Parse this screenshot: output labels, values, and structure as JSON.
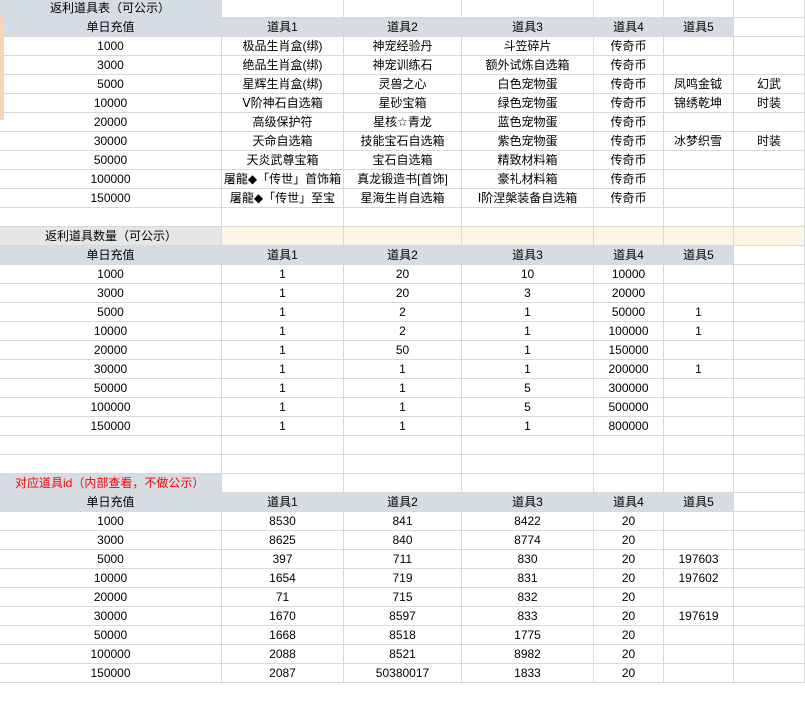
{
  "section1": {
    "title": "返利道具表（可公示）",
    "headers": [
      "单日充值",
      "道具1",
      "道具2",
      "道具3",
      "道具4",
      "道具5"
    ],
    "rows": [
      [
        "1000",
        "极品生肖盒(绑)",
        "神宠经验丹",
        "斗笠碎片",
        "传奇币",
        "",
        ""
      ],
      [
        "3000",
        "绝品生肖盒(绑)",
        "神宠训练石",
        "额外试炼自选箱",
        "传奇币",
        "",
        ""
      ],
      [
        "5000",
        "星辉生肖盒(绑)",
        "灵兽之心",
        "白色宠物蛋",
        "传奇币",
        "凤鸣金钺",
        "幻武"
      ],
      [
        "10000",
        "Ⅴ阶神石自选箱",
        "星砂宝箱",
        "绿色宠物蛋",
        "传奇币",
        "锦绣乾坤",
        "时装"
      ],
      [
        "20000",
        "高级保护符",
        "星核☆青龙",
        "蓝色宠物蛋",
        "传奇币",
        "",
        ""
      ],
      [
        "30000",
        "天命自选箱",
        "技能宝石自选箱",
        "紫色宠物蛋",
        "传奇币",
        "冰梦织雪",
        "时装"
      ],
      [
        "50000",
        "天炎武尊宝箱",
        "宝石自选箱",
        "精致材料箱",
        "传奇币",
        "",
        ""
      ],
      [
        "100000",
        "屠龍◆「传世」首饰箱",
        "真龙锻造书[首饰]",
        "豪礼材料箱",
        "传奇币",
        "",
        ""
      ],
      [
        "150000",
        "屠龍◆「传世」至宝",
        "星海生肖自选箱",
        "Ⅰ阶涅槃装备自选箱",
        "传奇币",
        "",
        ""
      ]
    ]
  },
  "section2": {
    "title": "返利道具数量（可公示）",
    "headers": [
      "单日充值",
      "道具1",
      "道具2",
      "道具3",
      "道具4",
      "道具5"
    ],
    "rows": [
      [
        "1000",
        "1",
        "20",
        "10",
        "10000",
        ""
      ],
      [
        "3000",
        "1",
        "20",
        "3",
        "20000",
        ""
      ],
      [
        "5000",
        "1",
        "2",
        "1",
        "50000",
        "1"
      ],
      [
        "10000",
        "1",
        "2",
        "1",
        "100000",
        "1"
      ],
      [
        "20000",
        "1",
        "50",
        "1",
        "150000",
        ""
      ],
      [
        "30000",
        "1",
        "1",
        "1",
        "200000",
        "1"
      ],
      [
        "50000",
        "1",
        "1",
        "5",
        "300000",
        ""
      ],
      [
        "100000",
        "1",
        "1",
        "5",
        "500000",
        ""
      ],
      [
        "150000",
        "1",
        "1",
        "1",
        "800000",
        ""
      ]
    ]
  },
  "section3": {
    "title": "对应道具id（内部查看，不做公示）",
    "headers": [
      "单日充值",
      "道具1",
      "道具2",
      "道具3",
      "道具4",
      "道具5"
    ],
    "rows": [
      [
        "1000",
        "8530",
        "841",
        "8422",
        "20",
        ""
      ],
      [
        "3000",
        "8625",
        "840",
        "8774",
        "20",
        ""
      ],
      [
        "5000",
        "397",
        "711",
        "830",
        "20",
        "197603"
      ],
      [
        "10000",
        "1654",
        "719",
        "831",
        "20",
        "197602"
      ],
      [
        "20000",
        "71",
        "715",
        "832",
        "20",
        ""
      ],
      [
        "30000",
        "1670",
        "8597",
        "833",
        "20",
        "197619"
      ],
      [
        "50000",
        "1668",
        "8518",
        "1775",
        "20",
        ""
      ],
      [
        "100000",
        "2088",
        "8521",
        "8982",
        "20",
        ""
      ],
      [
        "150000",
        "2087",
        "50380017",
        "1833",
        "20",
        ""
      ]
    ]
  }
}
